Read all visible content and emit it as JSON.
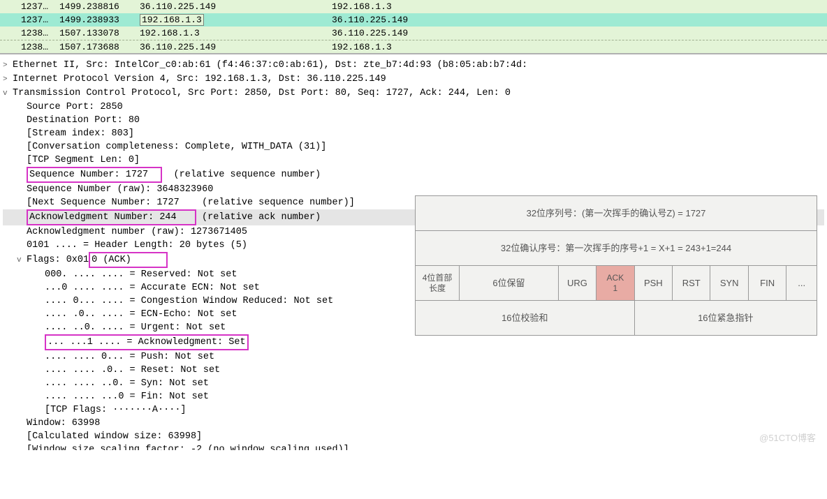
{
  "packet_list": [
    {
      "class": "green",
      "tree": "",
      "no": "1237…",
      "time": "1499.238816",
      "src": "36.110.225.149",
      "dst": "192.168.1.3"
    },
    {
      "class": "teal",
      "tree": "",
      "no": "1237…",
      "time": "1499.238933",
      "src_hl": "192.168.1.3",
      "dst": "36.110.225.149"
    },
    {
      "class": "green",
      "tree": "",
      "no": "1238…",
      "time": "1507.133078",
      "src": "192.168.1.3",
      "dst": "36.110.225.149"
    },
    {
      "class": "green",
      "tree": "",
      "no": "1238…",
      "time": "1507.173688",
      "src": "36.110.225.149",
      "dst": "192.168.1.3"
    }
  ],
  "eth": "Ethernet II, Src: IntelCor_c0:ab:61 (f4:46:37:c0:ab:61), Dst: zte_b7:4d:93 (b8:05:ab:b7:4d:",
  "ip": "Internet Protocol Version 4, Src: 192.168.1.3, Dst: 36.110.225.149",
  "tcp": "Transmission Control Protocol, Src Port: 2850, Dst Port: 80, Seq: 1727, Ack: 244, Len: 0",
  "d": {
    "srcport": "Source Port: 2850",
    "dstport": "Destination Port: 80",
    "stream": "[Stream index: 803]",
    "conv": "[Conversation completeness: Complete, WITH_DATA (31)]",
    "seglen": "[TCP Segment Len: 0]",
    "seq": "Sequence Number: 1727  ",
    "seq_suffix": "  (relative sequence number)",
    "seqraw": "Sequence Number (raw): 3648323960",
    "nextseq": "[Next Sequence Number: 1727    (relative sequence number)]",
    "ack": "Acknowledgment Number: 244   ",
    "ack_suffix": " (relative ack number)",
    "ackraw": "Acknowledgment number (raw): 1273671405",
    "hlen": "0101 .... = Header Length: 20 bytes (5)",
    "flags_pre": "Flags: 0x01",
    "flags_hl": "0 (ACK)      ",
    "f_res": "000. .... .... = Reserved: Not set",
    "f_ae": "...0 .... .... = Accurate ECN: Not set",
    "f_cwr": ".... 0... .... = Congestion Window Reduced: Not set",
    "f_ecn": ".... .0.. .... = ECN-Echo: Not set",
    "f_urg": ".... ..0. .... = Urgent: Not set",
    "f_ack": "... ...1 .... = Acknowledgment: Set",
    "f_psh": ".... .... 0... = Push: Not set",
    "f_rst": ".... .... .0.. = Reset: Not set",
    "f_syn": ".... .... ..0. = Syn: Not set",
    "f_fin": ".... .... ...0 = Fin: Not set",
    "f_str": "[TCP Flags: ·······A····]",
    "win": "Window: 63998",
    "calcwin": "[Calculated window size: 63998]",
    "last": "[Window size scaling factor: -2 (no window scaling used)]"
  },
  "table": {
    "r1": "32位序列号：(第一次挥手的确认号Z) = 1727",
    "r2": "32位确认序号：第一次挥手的序号+1 = X+1 = 243+1=244",
    "c1": "4位首部\n长度",
    "c2": "6位保留",
    "c3": "URG",
    "c4": "ACK\n1",
    "c5": "PSH",
    "c6": "RST",
    "c7": "SYN",
    "c8": "FIN",
    "c9": "...",
    "r4a": "16位校验和",
    "r4b": "16位紧急指针"
  },
  "watermark": "@51CTO博客"
}
